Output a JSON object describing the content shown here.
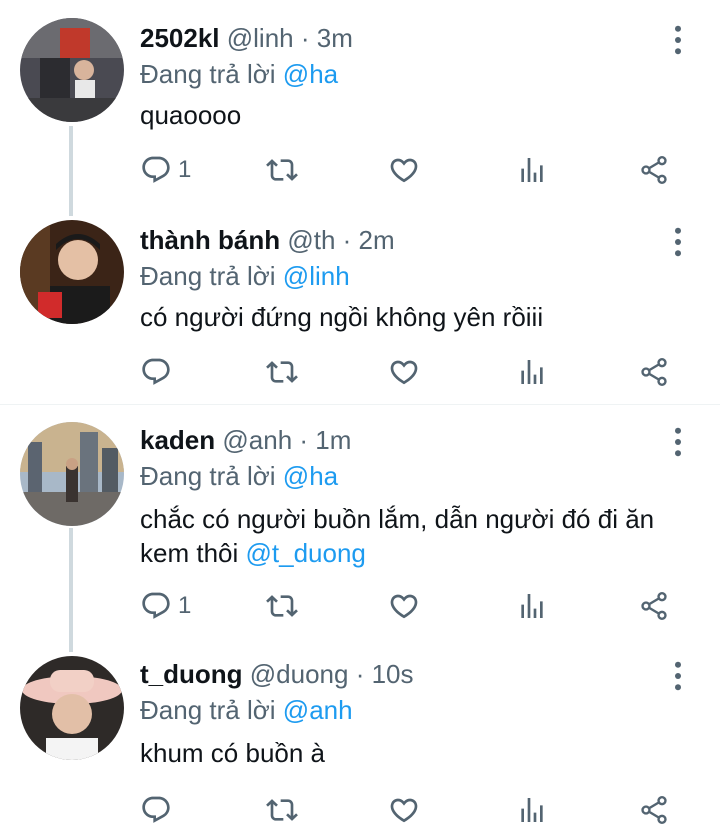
{
  "reply_prefix": "Đang trả lời",
  "tweets": [
    {
      "display_name": "2502kl",
      "handle": "@linh",
      "time": "3m",
      "reply_to": "@ha",
      "text": "quaoooo",
      "mention": "",
      "reply_count": "1"
    },
    {
      "display_name": "thành bánh",
      "handle": "@th",
      "time": "2m",
      "reply_to": "@linh",
      "text": "có người đứng ngồi không yên rồiii",
      "mention": "",
      "reply_count": ""
    },
    {
      "display_name": "kaden",
      "handle": "@anh",
      "time": "1m",
      "reply_to": "@ha",
      "text_line1": "chắc có người buồn lắm, dẫn người đó đi ăn",
      "text_line2": "kem thôi ",
      "mention": "@t_duong",
      "reply_count": "1"
    },
    {
      "display_name": "t_duong",
      "handle": "@duong",
      "time": "10s",
      "reply_to": "@anh",
      "text": "khum có buồn à",
      "mention": "",
      "reply_count": ""
    }
  ],
  "separator": " · ",
  "icons": [
    "more-icon",
    "reply-icon",
    "retweet-icon",
    "like-icon",
    "views-icon",
    "share-icon"
  ],
  "colors": {
    "mention": "#1d9bf0",
    "meta": "#536471",
    "thread_line": "#cfd9de"
  }
}
